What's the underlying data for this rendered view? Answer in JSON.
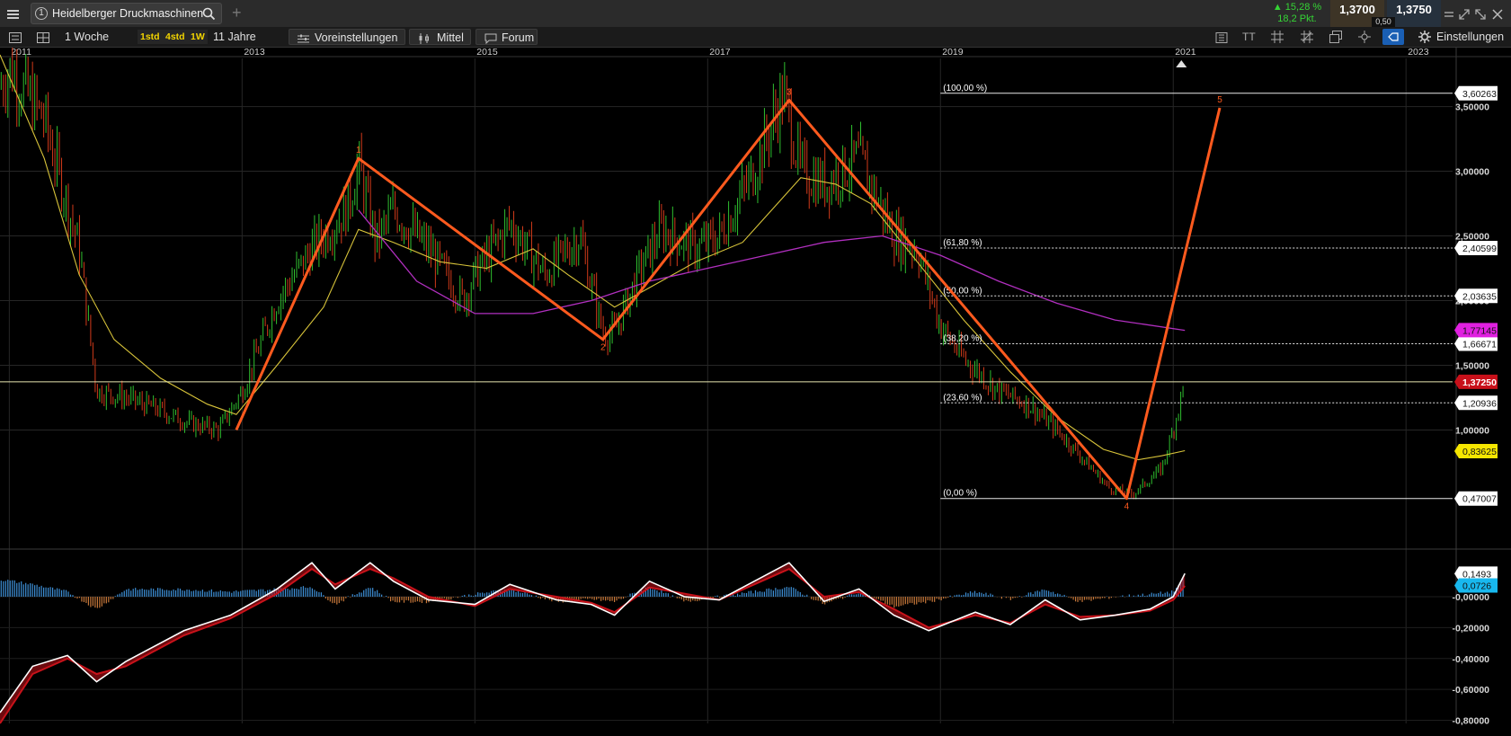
{
  "tab": {
    "number": "1",
    "title": "Heidelberger Druckmaschinen",
    "add_label": "+"
  },
  "quote": {
    "change_pct": "▲ 15,28 %",
    "change_pts": "18,2 Pkt.",
    "bid": "1,3700",
    "ask": "1,3750",
    "spread": "0,50"
  },
  "toolbar": {
    "interval": "1 Woche",
    "quick": [
      "1std",
      "4std",
      "1W"
    ],
    "range": "11 Jahre",
    "presets": "Voreinstellungen",
    "indicator": "Mittel",
    "forum": "Forum",
    "settings": "Einstellungen",
    "text_tool": "TT"
  },
  "colors": {
    "up": "#2fbf2f",
    "down": "#d23a1a",
    "wave": "#ff5a1e",
    "sma_fast": "#d8c43a",
    "sma_slow": "#b12fbf",
    "macd_line": "#ffffff",
    "macd_signal": "#c8121a",
    "hist_up": "#3d8fd6",
    "hist_down": "#c7783a",
    "price_tag": "#c8101a",
    "fib_tag_bg": "#ffffff",
    "sma_fast_tag": "#f5e600",
    "sma_slow_tag": "#e020e0",
    "macd_tag": "#18b8ee"
  },
  "chart_data": {
    "type": "candlestick",
    "title": "Heidelberger Druckmaschinen",
    "x_axis_labels": [
      "2011",
      "2013",
      "2015",
      "2017",
      "2019",
      "2021",
      "2023"
    ],
    "x_range": [
      2010.9,
      2023.4
    ],
    "y_range": [
      0.1,
      3.9
    ],
    "y_axis_labels": [
      "3,50000",
      "3,00000",
      "2,50000",
      "2,00000",
      "1,50000",
      "1,00000"
    ],
    "y_axis_values": [
      3.5,
      3.0,
      2.5,
      2.0,
      1.5,
      1.0
    ],
    "price_path": [
      [
        2010.92,
        3.65
      ],
      [
        2011.0,
        3.8
      ],
      [
        2011.3,
        3.4
      ],
      [
        2011.6,
        2.4
      ],
      [
        2011.75,
        1.3
      ],
      [
        2012.0,
        1.25
      ],
      [
        2012.3,
        1.15
      ],
      [
        2012.55,
        1.05
      ],
      [
        2012.8,
        1.0
      ],
      [
        2013.0,
        1.3
      ],
      [
        2013.3,
        2.0
      ],
      [
        2013.6,
        2.4
      ],
      [
        2013.9,
        2.7
      ],
      [
        2014.0,
        3.05
      ],
      [
        2014.15,
        2.45
      ],
      [
        2014.3,
        2.7
      ],
      [
        2014.6,
        2.4
      ],
      [
        2014.9,
        2.0
      ],
      [
        2015.0,
        2.2
      ],
      [
        2015.3,
        2.6
      ],
      [
        2015.6,
        2.2
      ],
      [
        2015.9,
        2.5
      ],
      [
        2016.1,
        1.75
      ],
      [
        2016.2,
        1.75
      ],
      [
        2016.4,
        2.2
      ],
      [
        2016.6,
        2.55
      ],
      [
        2016.9,
        2.4
      ],
      [
        2017.1,
        2.5
      ],
      [
        2017.4,
        3.0
      ],
      [
        2017.65,
        3.6
      ],
      [
        2017.8,
        3.0
      ],
      [
        2018.0,
        2.9
      ],
      [
        2018.3,
        3.1
      ],
      [
        2018.6,
        2.5
      ],
      [
        2018.8,
        2.4
      ],
      [
        2018.9,
        2.1
      ],
      [
        2019.0,
        1.8
      ],
      [
        2019.2,
        1.55
      ],
      [
        2019.5,
        1.3
      ],
      [
        2019.75,
        1.2
      ],
      [
        2020.0,
        1.0
      ],
      [
        2020.25,
        0.75
      ],
      [
        2020.45,
        0.55
      ],
      [
        2020.65,
        0.5
      ],
      [
        2020.9,
        0.7
      ],
      [
        2021.0,
        1.0
      ],
      [
        2021.1,
        1.37
      ]
    ],
    "sma_fast": [
      [
        2010.92,
        3.9
      ],
      [
        2011.3,
        3.1
      ],
      [
        2011.6,
        2.2
      ],
      [
        2011.9,
        1.7
      ],
      [
        2012.3,
        1.4
      ],
      [
        2012.7,
        1.2
      ],
      [
        2012.95,
        1.12
      ],
      [
        2013.3,
        1.5
      ],
      [
        2013.7,
        1.95
      ],
      [
        2014.0,
        2.55
      ],
      [
        2014.3,
        2.45
      ],
      [
        2014.7,
        2.3
      ],
      [
        2015.1,
        2.25
      ],
      [
        2015.5,
        2.4
      ],
      [
        2015.8,
        2.2
      ],
      [
        2016.2,
        1.95
      ],
      [
        2016.5,
        2.1
      ],
      [
        2016.9,
        2.3
      ],
      [
        2017.3,
        2.45
      ],
      [
        2017.6,
        2.75
      ],
      [
        2017.8,
        2.95
      ],
      [
        2018.1,
        2.9
      ],
      [
        2018.4,
        2.75
      ],
      [
        2018.8,
        2.3
      ],
      [
        2019.2,
        1.85
      ],
      [
        2019.6,
        1.45
      ],
      [
        2020.0,
        1.1
      ],
      [
        2020.4,
        0.85
      ],
      [
        2020.7,
        0.77
      ],
      [
        2020.9,
        0.8
      ],
      [
        2021.1,
        0.84
      ]
    ],
    "sma_slow": [
      [
        2014.0,
        2.7
      ],
      [
        2014.5,
        2.15
      ],
      [
        2015.0,
        1.9
      ],
      [
        2015.5,
        1.9
      ],
      [
        2016.0,
        2.0
      ],
      [
        2016.5,
        2.15
      ],
      [
        2017.0,
        2.25
      ],
      [
        2017.5,
        2.35
      ],
      [
        2018.0,
        2.45
      ],
      [
        2018.5,
        2.5
      ],
      [
        2019.0,
        2.35
      ],
      [
        2019.5,
        2.15
      ],
      [
        2020.0,
        1.98
      ],
      [
        2020.5,
        1.85
      ],
      [
        2021.1,
        1.77
      ]
    ],
    "elliott_wave": {
      "labels": [
        "1",
        "2",
        "3",
        "4",
        "5"
      ],
      "points": [
        [
          2012.95,
          1.0
        ],
        [
          2014.0,
          3.1
        ],
        [
          2016.1,
          1.7
        ],
        [
          2017.7,
          3.55
        ],
        [
          2020.6,
          0.47
        ],
        [
          2021.4,
          3.49
        ]
      ]
    },
    "fibonacci": {
      "x_start": 2019.0,
      "levels": [
        {
          "label": "(100,00 %)",
          "value": 3.60263,
          "tag": "3,60263"
        },
        {
          "label": "(61,80 %)",
          "value": 2.40599,
          "tag": "2,40599"
        },
        {
          "label": "(50,00 %)",
          "value": 2.03635,
          "tag": "2,03635"
        },
        {
          "label": "(38,20 %)",
          "value": 1.66671,
          "tag": "1,66671"
        },
        {
          "label": "(23,60 %)",
          "value": 1.20936,
          "tag": "1,20936"
        },
        {
          "label": "(0,00 %)",
          "value": 0.47007,
          "tag": "0,47007"
        }
      ]
    },
    "last_price": {
      "value": 1.3725,
      "tag": "1,37250"
    },
    "sma_fast_tag": "0,83625",
    "sma_slow_tag": "1,77145",
    "macd": {
      "y_range": [
        -0.82,
        0.32
      ],
      "y_axis_labels": [
        "-0,00000",
        "-0,20000",
        "-0,40000",
        "-0,60000",
        "-0,80000"
      ],
      "y_axis_values": [
        0.0,
        -0.2,
        -0.4,
        -0.6,
        -0.8
      ],
      "tags": [
        "0,1493",
        "0,0726"
      ],
      "line": [
        [
          2010.92,
          -0.75
        ],
        [
          2011.2,
          -0.45
        ],
        [
          2011.5,
          -0.38
        ],
        [
          2011.75,
          -0.55
        ],
        [
          2012.0,
          -0.42
        ],
        [
          2012.5,
          -0.22
        ],
        [
          2012.9,
          -0.12
        ],
        [
          2013.3,
          0.05
        ],
        [
          2013.6,
          0.22
        ],
        [
          2013.8,
          0.05
        ],
        [
          2014.1,
          0.22
        ],
        [
          2014.3,
          0.1
        ],
        [
          2014.6,
          -0.02
        ],
        [
          2015.0,
          -0.05
        ],
        [
          2015.3,
          0.08
        ],
        [
          2015.7,
          -0.02
        ],
        [
          2016.0,
          -0.05
        ],
        [
          2016.2,
          -0.12
        ],
        [
          2016.5,
          0.1
        ],
        [
          2016.8,
          0.0
        ],
        [
          2017.1,
          -0.02
        ],
        [
          2017.4,
          0.1
        ],
        [
          2017.7,
          0.22
        ],
        [
          2018.0,
          -0.03
        ],
        [
          2018.3,
          0.05
        ],
        [
          2018.6,
          -0.12
        ],
        [
          2018.9,
          -0.22
        ],
        [
          2019.3,
          -0.1
        ],
        [
          2019.6,
          -0.18
        ],
        [
          2019.9,
          -0.02
        ],
        [
          2020.2,
          -0.15
        ],
        [
          2020.5,
          -0.12
        ],
        [
          2020.8,
          -0.08
        ],
        [
          2021.0,
          0.0
        ],
        [
          2021.1,
          0.15
        ]
      ],
      "signal": [
        [
          2010.92,
          -0.82
        ],
        [
          2011.2,
          -0.5
        ],
        [
          2011.5,
          -0.4
        ],
        [
          2011.75,
          -0.5
        ],
        [
          2012.0,
          -0.45
        ],
        [
          2012.5,
          -0.25
        ],
        [
          2012.9,
          -0.14
        ],
        [
          2013.3,
          0.02
        ],
        [
          2013.6,
          0.18
        ],
        [
          2013.8,
          0.08
        ],
        [
          2014.1,
          0.18
        ],
        [
          2014.3,
          0.12
        ],
        [
          2014.6,
          0.0
        ],
        [
          2015.0,
          -0.06
        ],
        [
          2015.3,
          0.05
        ],
        [
          2015.7,
          0.0
        ],
        [
          2016.0,
          -0.04
        ],
        [
          2016.2,
          -0.1
        ],
        [
          2016.5,
          0.06
        ],
        [
          2016.8,
          0.02
        ],
        [
          2017.1,
          -0.02
        ],
        [
          2017.4,
          0.08
        ],
        [
          2017.7,
          0.18
        ],
        [
          2018.0,
          0.0
        ],
        [
          2018.3,
          0.03
        ],
        [
          2018.6,
          -0.08
        ],
        [
          2018.9,
          -0.2
        ],
        [
          2019.3,
          -0.12
        ],
        [
          2019.6,
          -0.17
        ],
        [
          2019.9,
          -0.05
        ],
        [
          2020.2,
          -0.13
        ],
        [
          2020.5,
          -0.12
        ],
        [
          2020.8,
          -0.09
        ],
        [
          2021.0,
          -0.02
        ],
        [
          2021.1,
          0.07
        ]
      ]
    }
  }
}
